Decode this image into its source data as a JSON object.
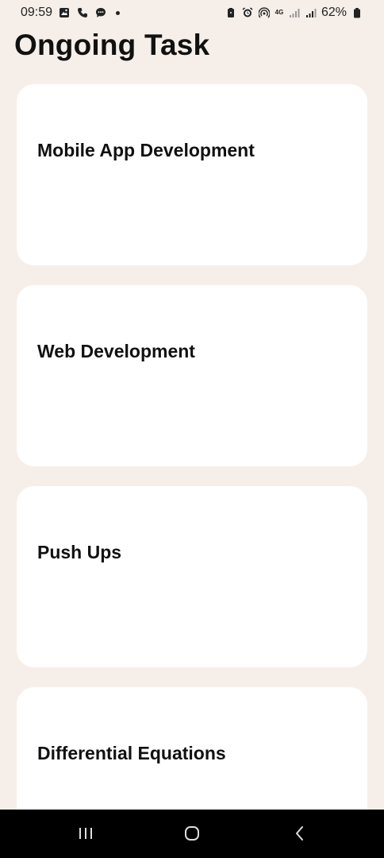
{
  "status_bar": {
    "time": "09:59",
    "network": "4G",
    "battery": "62%",
    "left_icons": [
      "gallery-icon",
      "phone-icon",
      "message-icon",
      "notification-dot-icon"
    ],
    "right_icons": [
      "battery-saver-icon",
      "alarm-icon",
      "hotspot-icon",
      "network-icon",
      "signal-1-icon",
      "signal-2-icon",
      "battery-icon"
    ]
  },
  "header": {
    "title": "Ongoing Task"
  },
  "tasks": [
    {
      "title": "Mobile App Development"
    },
    {
      "title": "Web Development"
    },
    {
      "title": "Push Ups"
    },
    {
      "title": "Differential Equations"
    }
  ],
  "nav_bar": {
    "buttons": [
      "recent-apps-icon",
      "home-icon",
      "back-icon"
    ]
  },
  "colors": {
    "background": "#f6efe9",
    "card": "#ffffff",
    "text": "#111111",
    "nav_bar": "#000000"
  }
}
